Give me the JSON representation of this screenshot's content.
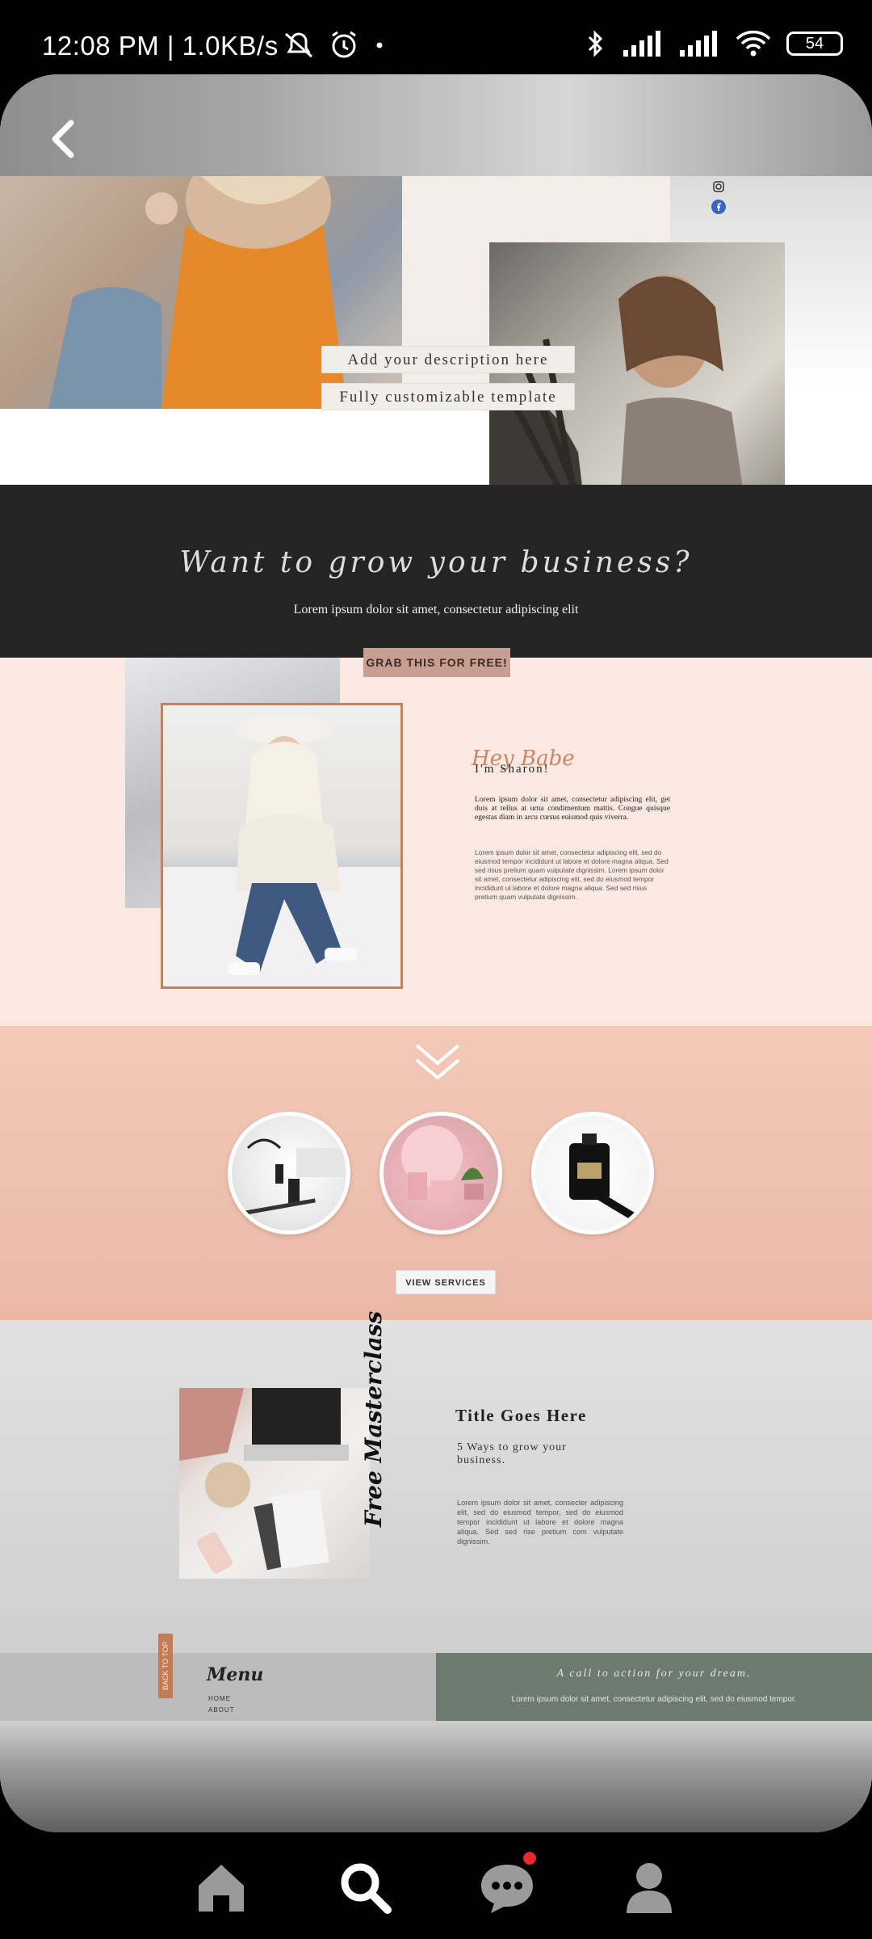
{
  "status": {
    "time_speed": "12:08 PM | 1.0KB/s",
    "battery": "54"
  },
  "nav": {
    "back_label": "Back"
  },
  "hero": {
    "desc_line1": "Add your description here",
    "desc_line2": "Fully customizable template"
  },
  "cta_section": {
    "script": "Want to grow your business?",
    "lorem": "Lorem ipsum dolor sit amet, consectetur adipiscing elit",
    "button": "GRAB THIS FOR FREE!"
  },
  "about": {
    "hey": "Hey Babe",
    "name": "I'm Sharon!",
    "lead": "Lorem ipsum dolor sit amet, consectetur adipiscing elit, get duis at tellus at urna condimentum mattis. Congue quisque egestas diam in arcu cursus euismod quis viverra.",
    "body": "Lorem ipsum dolor sit amet, consectetur adipiscing elit, sed do eiusmod tempor incididunt ut labore et dolore magna aliqua. Sed sed risus pretium quam vulputate dignissim. Lorem ipsum dolor sit amet, consectetur adipiscing elit, sed do eiusmod tempor incididunt ut labore et dolore magna aliqua. Sed sed risus pretium quam vulputate dignissim."
  },
  "services": {
    "button": "VIEW SERVICES"
  },
  "masterclass": {
    "script": "Free Masterclass",
    "title": "Title Goes Here",
    "subtitle": "5 Ways to grow your business.",
    "body": "Lorem ipsum dolor sit amet, consecter adipiscing elit, sed do eiusmod tempor, sed do eiusmod tempor incididunt ut labore et dolore magna aliqua. Sed sed rise pretium com vulputate dignissim."
  },
  "footer": {
    "back_to_top": "BACK TO TOP",
    "menu_title": "Menu",
    "menu_items": [
      "HOME",
      "ABOUT"
    ],
    "cta": "A call to action for your dream.",
    "cta_body": "Lorem ipsum dolor sit amet, consectetur adipiscing elit, sed do eiusmod tempor."
  },
  "icons": {
    "back": "chevron-left-icon",
    "home": "home-icon",
    "search": "search-icon",
    "chat": "chat-icon",
    "profile": "profile-icon"
  },
  "colors": {
    "dark_band": "#242424",
    "peach": "#fbe9e1",
    "salmon": "#f3c9b8",
    "accent": "#c4825a",
    "green": "#6c7b6e",
    "notification": "#e32b2b"
  }
}
